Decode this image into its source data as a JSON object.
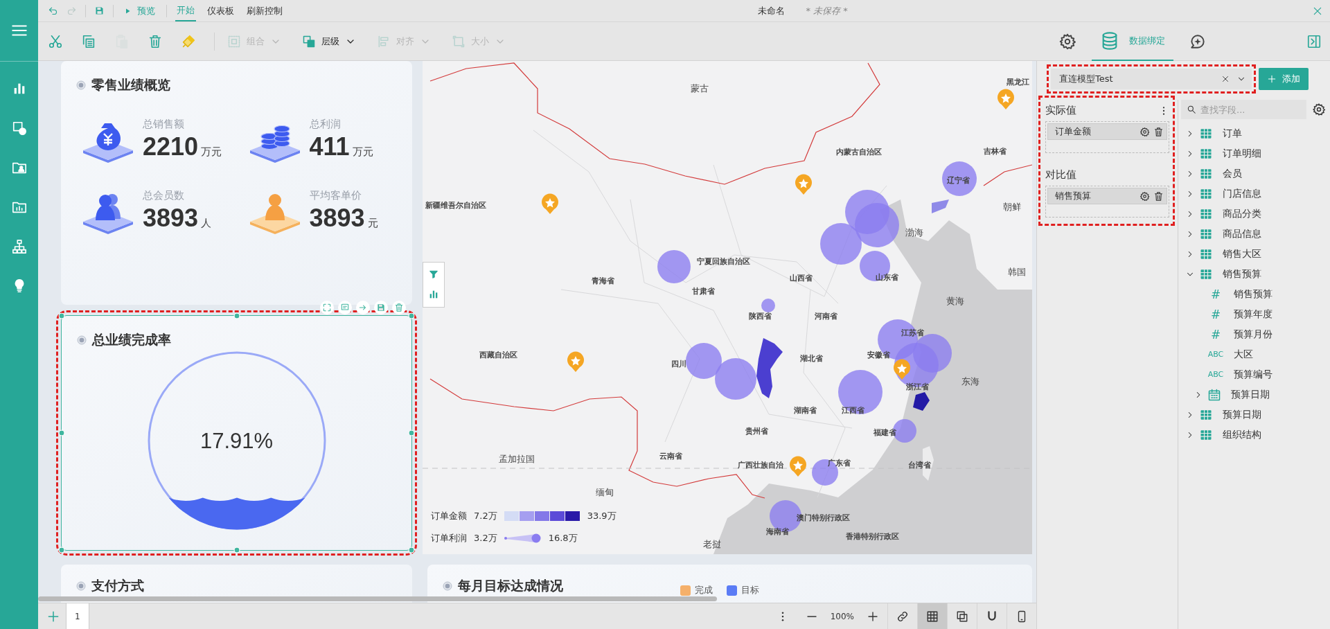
{
  "side_nav": {
    "items": [
      {
        "kind": "menu"
      },
      {
        "kind": "chart"
      },
      {
        "kind": "shapes"
      },
      {
        "kind": "data-folder"
      },
      {
        "kind": "chart-folder"
      },
      {
        "kind": "hierarchy"
      },
      {
        "kind": "idea"
      }
    ]
  },
  "topbar": {
    "quick_actions": [
      {
        "kind": "undo",
        "disabled": false
      },
      {
        "kind": "redo",
        "disabled": true
      },
      {
        "kind": "save",
        "disabled": false
      }
    ],
    "preview_button": "预览",
    "tabs": [
      {
        "label": "开始",
        "selected": true
      },
      {
        "label": "仪表板",
        "selected": false
      },
      {
        "label": "刷新控制",
        "selected": false
      }
    ],
    "document_title": "未命名",
    "save_status": "* 未保存 *"
  },
  "toolbar": {
    "edit_tools": [
      {
        "kind": "cut",
        "disabled": false
      },
      {
        "kind": "copy",
        "disabled": false
      },
      {
        "kind": "paste",
        "disabled": true
      },
      {
        "kind": "delete",
        "disabled": false
      },
      {
        "kind": "format",
        "disabled": false
      }
    ],
    "groups": [
      {
        "kind": "group",
        "label": "组合",
        "disabled": true
      },
      {
        "kind": "layers",
        "label": "层级",
        "disabled": false
      },
      {
        "kind": "align",
        "label": "对齐",
        "disabled": true
      },
      {
        "kind": "size",
        "label": "大小",
        "disabled": true
      }
    ],
    "panel_tabs": [
      {
        "kind": "settings",
        "selected": false
      },
      {
        "kind": "data",
        "label": "数据绑定",
        "selected": true
      },
      {
        "kind": "ai",
        "selected": false
      }
    ]
  },
  "dashboard": {
    "overview": {
      "title": "零售业绩概览",
      "kpis": [
        {
          "kind": "sales",
          "label": "总销售额",
          "value": "2210",
          "unit": "万元"
        },
        {
          "kind": "profit",
          "label": "总利润",
          "value": "411",
          "unit": "万元"
        },
        {
          "kind": "members",
          "label": "总会员数",
          "value": "3893",
          "unit": "人"
        },
        {
          "kind": "price",
          "label": "平均客单价",
          "value": "3893",
          "unit": "元"
        }
      ]
    },
    "completion": {
      "title": "总业绩完成率",
      "value": "17.91%",
      "level": 0.1791,
      "selected": true
    },
    "map": {
      "labels": [
        {
          "text": "蒙古",
          "kind": "country"
        },
        {
          "text": "黑龙江",
          "kind": "province"
        },
        {
          "text": "内蒙古自治区",
          "kind": "province"
        },
        {
          "text": "吉林省",
          "kind": "province"
        },
        {
          "text": "新疆维吾尔自治区",
          "kind": "province"
        },
        {
          "text": "辽宁省",
          "kind": "province"
        },
        {
          "text": "朝鲜",
          "kind": "country"
        },
        {
          "text": "渤海",
          "kind": "country"
        },
        {
          "text": "宁夏回族自治区",
          "kind": "province"
        },
        {
          "text": "青海省",
          "kind": "province"
        },
        {
          "text": "山西省",
          "kind": "province"
        },
        {
          "text": "山东省",
          "kind": "province"
        },
        {
          "text": "韩国",
          "kind": "country"
        },
        {
          "text": "甘肃省",
          "kind": "province"
        },
        {
          "text": "黄海",
          "kind": "country"
        },
        {
          "text": "陕西省",
          "kind": "province"
        },
        {
          "text": "河南省",
          "kind": "province"
        },
        {
          "text": "江苏省",
          "kind": "province"
        },
        {
          "text": "西藏自治区",
          "kind": "province"
        },
        {
          "text": "湖北省",
          "kind": "province"
        },
        {
          "text": "安徽省",
          "kind": "province"
        },
        {
          "text": "四川",
          "kind": "province"
        },
        {
          "text": "东海",
          "kind": "country"
        },
        {
          "text": "浙江省",
          "kind": "province"
        },
        {
          "text": "湖南省",
          "kind": "province"
        },
        {
          "text": "江西省",
          "kind": "province"
        },
        {
          "text": "贵州省",
          "kind": "province"
        },
        {
          "text": "福建省",
          "kind": "province"
        },
        {
          "text": "孟加拉国",
          "kind": "country"
        },
        {
          "text": "云南省",
          "kind": "province"
        },
        {
          "text": "广西壮族自治",
          "kind": "province"
        },
        {
          "text": "广东省",
          "kind": "province"
        },
        {
          "text": "台湾省",
          "kind": "province"
        },
        {
          "text": "缅甸",
          "kind": "country"
        },
        {
          "text": "澳门特别行政区",
          "kind": "province"
        },
        {
          "text": "海南省",
          "kind": "province"
        },
        {
          "text": "香港特别行政区",
          "kind": "province"
        },
        {
          "text": "老挝",
          "kind": "country"
        }
      ],
      "legend": [
        {
          "kind": "color",
          "label": "订单金额",
          "min": "7.2万",
          "max": "33.9万"
        },
        {
          "kind": "size",
          "label": "订单利润",
          "min": "3.2万",
          "max": "16.8万"
        }
      ]
    },
    "bottom_cards": [
      {
        "title": "支付方式"
      },
      {
        "title": "每月目标达成情况",
        "legend": [
          {
            "label": "完成",
            "color": "#f5b06a"
          },
          {
            "label": "目标",
            "color": "#5b7cf5"
          }
        ]
      }
    ]
  },
  "pager": {
    "pages": [
      {
        "label": "1",
        "selected": true
      }
    ],
    "zoom": "100%",
    "view_tools": [
      {
        "kind": "link",
        "on": false
      },
      {
        "kind": "grid",
        "on": true
      },
      {
        "kind": "overlap",
        "on": false
      },
      {
        "kind": "magnet",
        "on": false
      },
      {
        "kind": "mobile",
        "on": false
      }
    ]
  },
  "data_panel": {
    "model": {
      "value": "直连模型Test"
    },
    "add_button": "添加",
    "wells": [
      {
        "title": "实际值",
        "more_menu": true,
        "fields": [
          "订单金额"
        ]
      },
      {
        "title": "对比值",
        "more_menu": false,
        "fields": [
          "销售预算"
        ]
      }
    ],
    "search": {
      "placeholder": "查找字段..."
    },
    "tree": [
      {
        "label": "订单",
        "kind": "table",
        "expanded": false
      },
      {
        "label": "订单明细",
        "kind": "table",
        "expanded": false
      },
      {
        "label": "会员",
        "kind": "table",
        "expanded": false
      },
      {
        "label": "门店信息",
        "kind": "table",
        "expanded": false
      },
      {
        "label": "商品分类",
        "kind": "table",
        "expanded": false
      },
      {
        "label": "商品信息",
        "kind": "table",
        "expanded": false
      },
      {
        "label": "销售大区",
        "kind": "table",
        "expanded": false
      },
      {
        "label": "销售预算",
        "kind": "table",
        "expanded": true,
        "children": [
          {
            "label": "销售预算",
            "kind": "number",
            "type_label": "#"
          },
          {
            "label": "预算年度",
            "kind": "number",
            "type_label": "#"
          },
          {
            "label": "预算月份",
            "kind": "number",
            "type_label": "#"
          },
          {
            "label": "大区",
            "kind": "text",
            "type_label": "ABC"
          },
          {
            "label": "预算编号",
            "kind": "text",
            "type_label": "ABC"
          },
          {
            "label": "预算日期",
            "kind": "date",
            "expanded": false
          }
        ]
      },
      {
        "label": "预算日期",
        "kind": "table",
        "expanded": false
      },
      {
        "label": "组织结构",
        "kind": "table",
        "expanded": false
      }
    ]
  }
}
